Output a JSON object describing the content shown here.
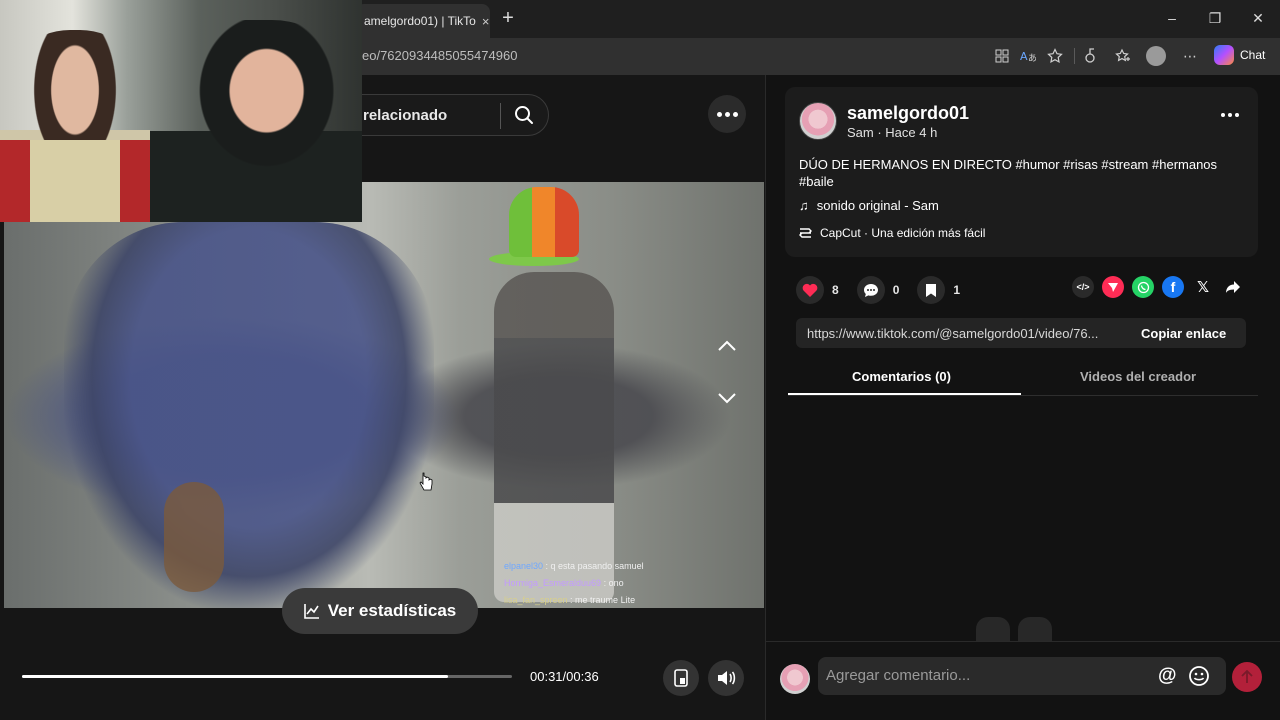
{
  "browser": {
    "tab_title": "amelgordo01) | TikTo",
    "url": "eo/7620934485055474960",
    "copilot_label": "Chat",
    "new_tab_symbol": "+",
    "close_symbol": "×"
  },
  "left_panel": {
    "search_text": "relacionado",
    "stats_button_label": "Ver estadísticas",
    "time_display": "00:31/00:36",
    "progress": 0.87
  },
  "live_chat": [
    {
      "user": "elpanel30",
      "message": " : q esta pasando samuel"
    },
    {
      "user": "Hormiga_Esmeralduu69",
      "message": " : ono"
    },
    {
      "user": "lisa_fan_spreen",
      "message": " : me traume Lite"
    }
  ],
  "post": {
    "author": "samelgordo01",
    "subtitle": "Sam · Hace 4 h",
    "description": "DÚO DE HERMANOS EN DIRECTO #humor #risas #stream #hermanos #baile",
    "sound": "sonido original - Sam",
    "capcut": "CapCut · Una edición más fácil",
    "likes": "8",
    "comments": "0",
    "saves": "1",
    "link": "https://www.tiktok.com/@samelgordo01/video/76...",
    "copy_label": "Copiar enlace"
  },
  "tabs": {
    "comments": "Comentarios (0)",
    "creator_videos": "Videos del creador"
  },
  "comment_input": {
    "placeholder": "Agregar comentario...",
    "at_symbol": "@"
  },
  "colors": {
    "like": "#fe2c55",
    "whatsapp": "#25d366",
    "facebook": "#1877f2",
    "send": "#b3203a"
  }
}
